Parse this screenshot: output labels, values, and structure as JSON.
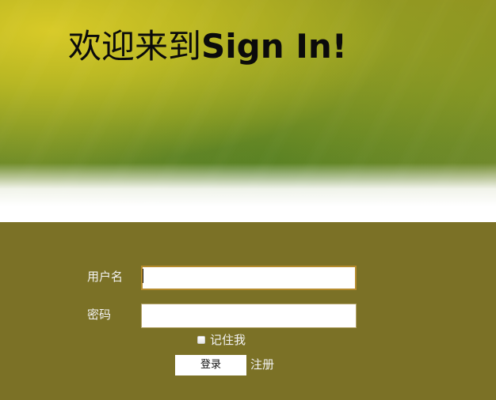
{
  "hero": {
    "title_prefix": "欢迎来到",
    "title_brand": "Sign In!"
  },
  "form": {
    "username_label": "用户名",
    "username_value": "",
    "username_placeholder": "",
    "password_label": "密码",
    "password_value": "",
    "password_placeholder": "",
    "remember_label": "记住我",
    "remember_checked": false,
    "login_button_label": "登录",
    "register_link_label": "注册"
  },
  "colors": {
    "panel_background": "#7b7126",
    "panel_text": "#f2f2f2",
    "focused_input_border": "#b58b2d"
  }
}
